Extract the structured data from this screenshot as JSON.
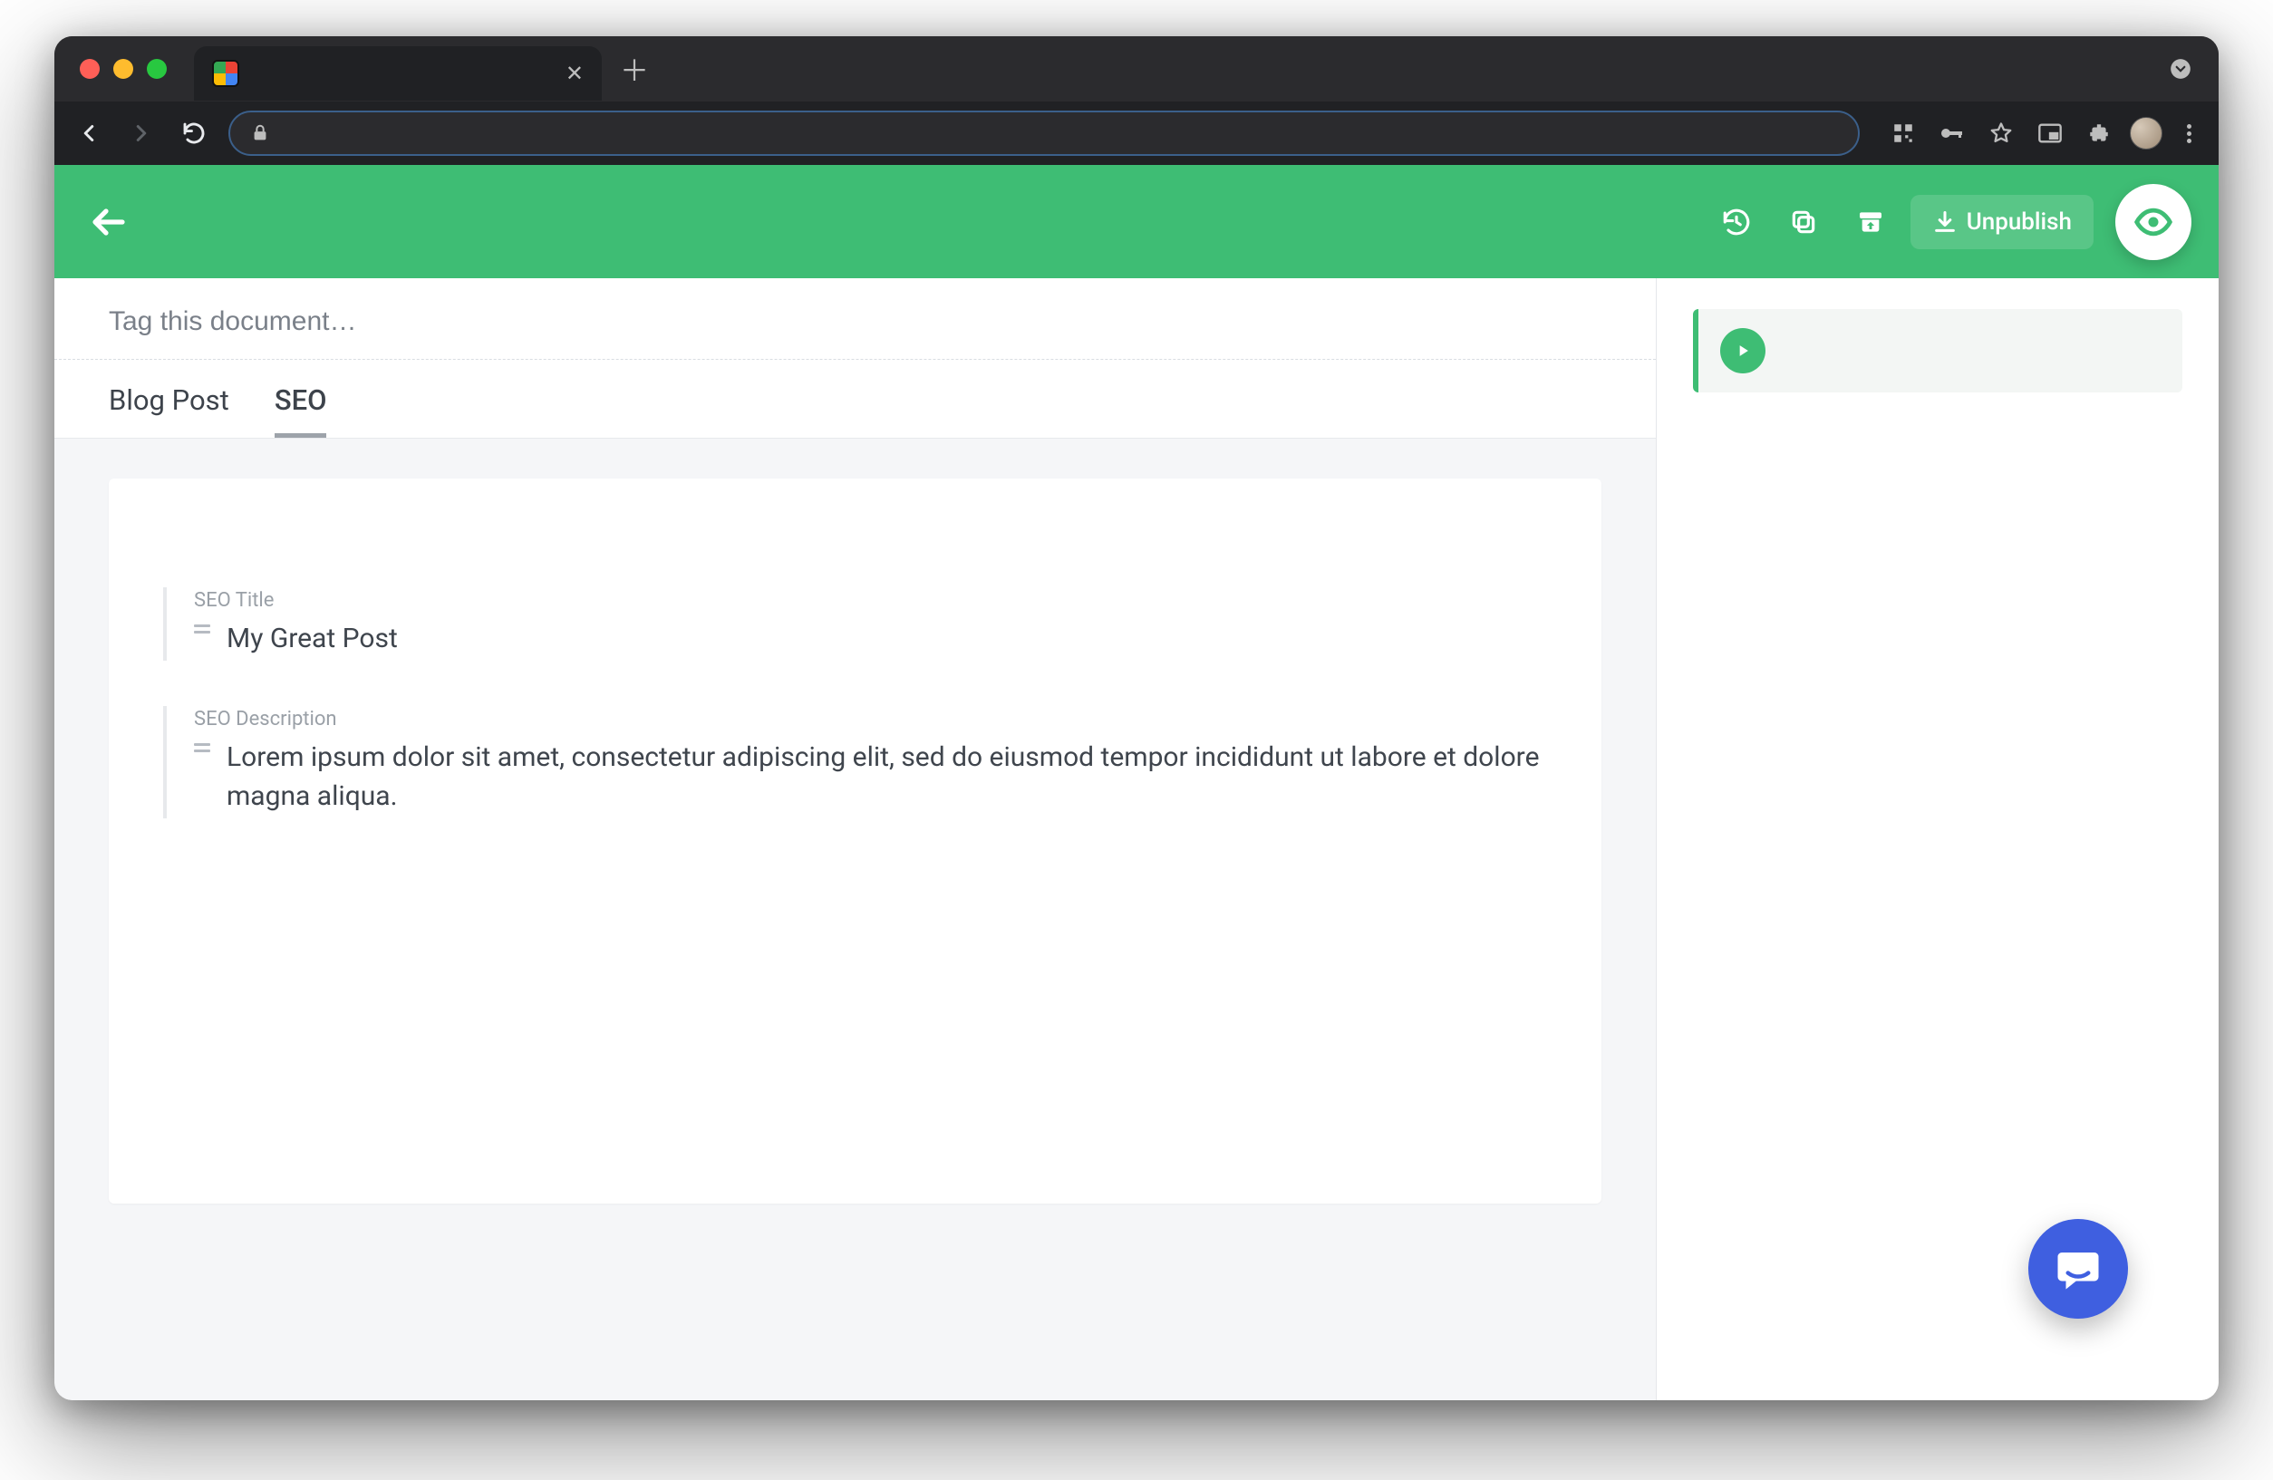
{
  "browser": {
    "tab_title": "",
    "url": ""
  },
  "header": {
    "unpublish_label": "Unpublish"
  },
  "tag_input": {
    "placeholder": "Tag this document…",
    "value": ""
  },
  "tabs": [
    {
      "label": "Blog Post",
      "active": false
    },
    {
      "label": "SEO",
      "active": true
    }
  ],
  "fields": {
    "seo_title": {
      "label": "SEO Title",
      "value": "My Great Post"
    },
    "seo_description": {
      "label": "SEO Description",
      "value": "Lorem ipsum dolor sit amet, consectetur adipiscing elit, sed do eiusmod tempor incididunt ut labore et dolore magna aliqua."
    }
  }
}
